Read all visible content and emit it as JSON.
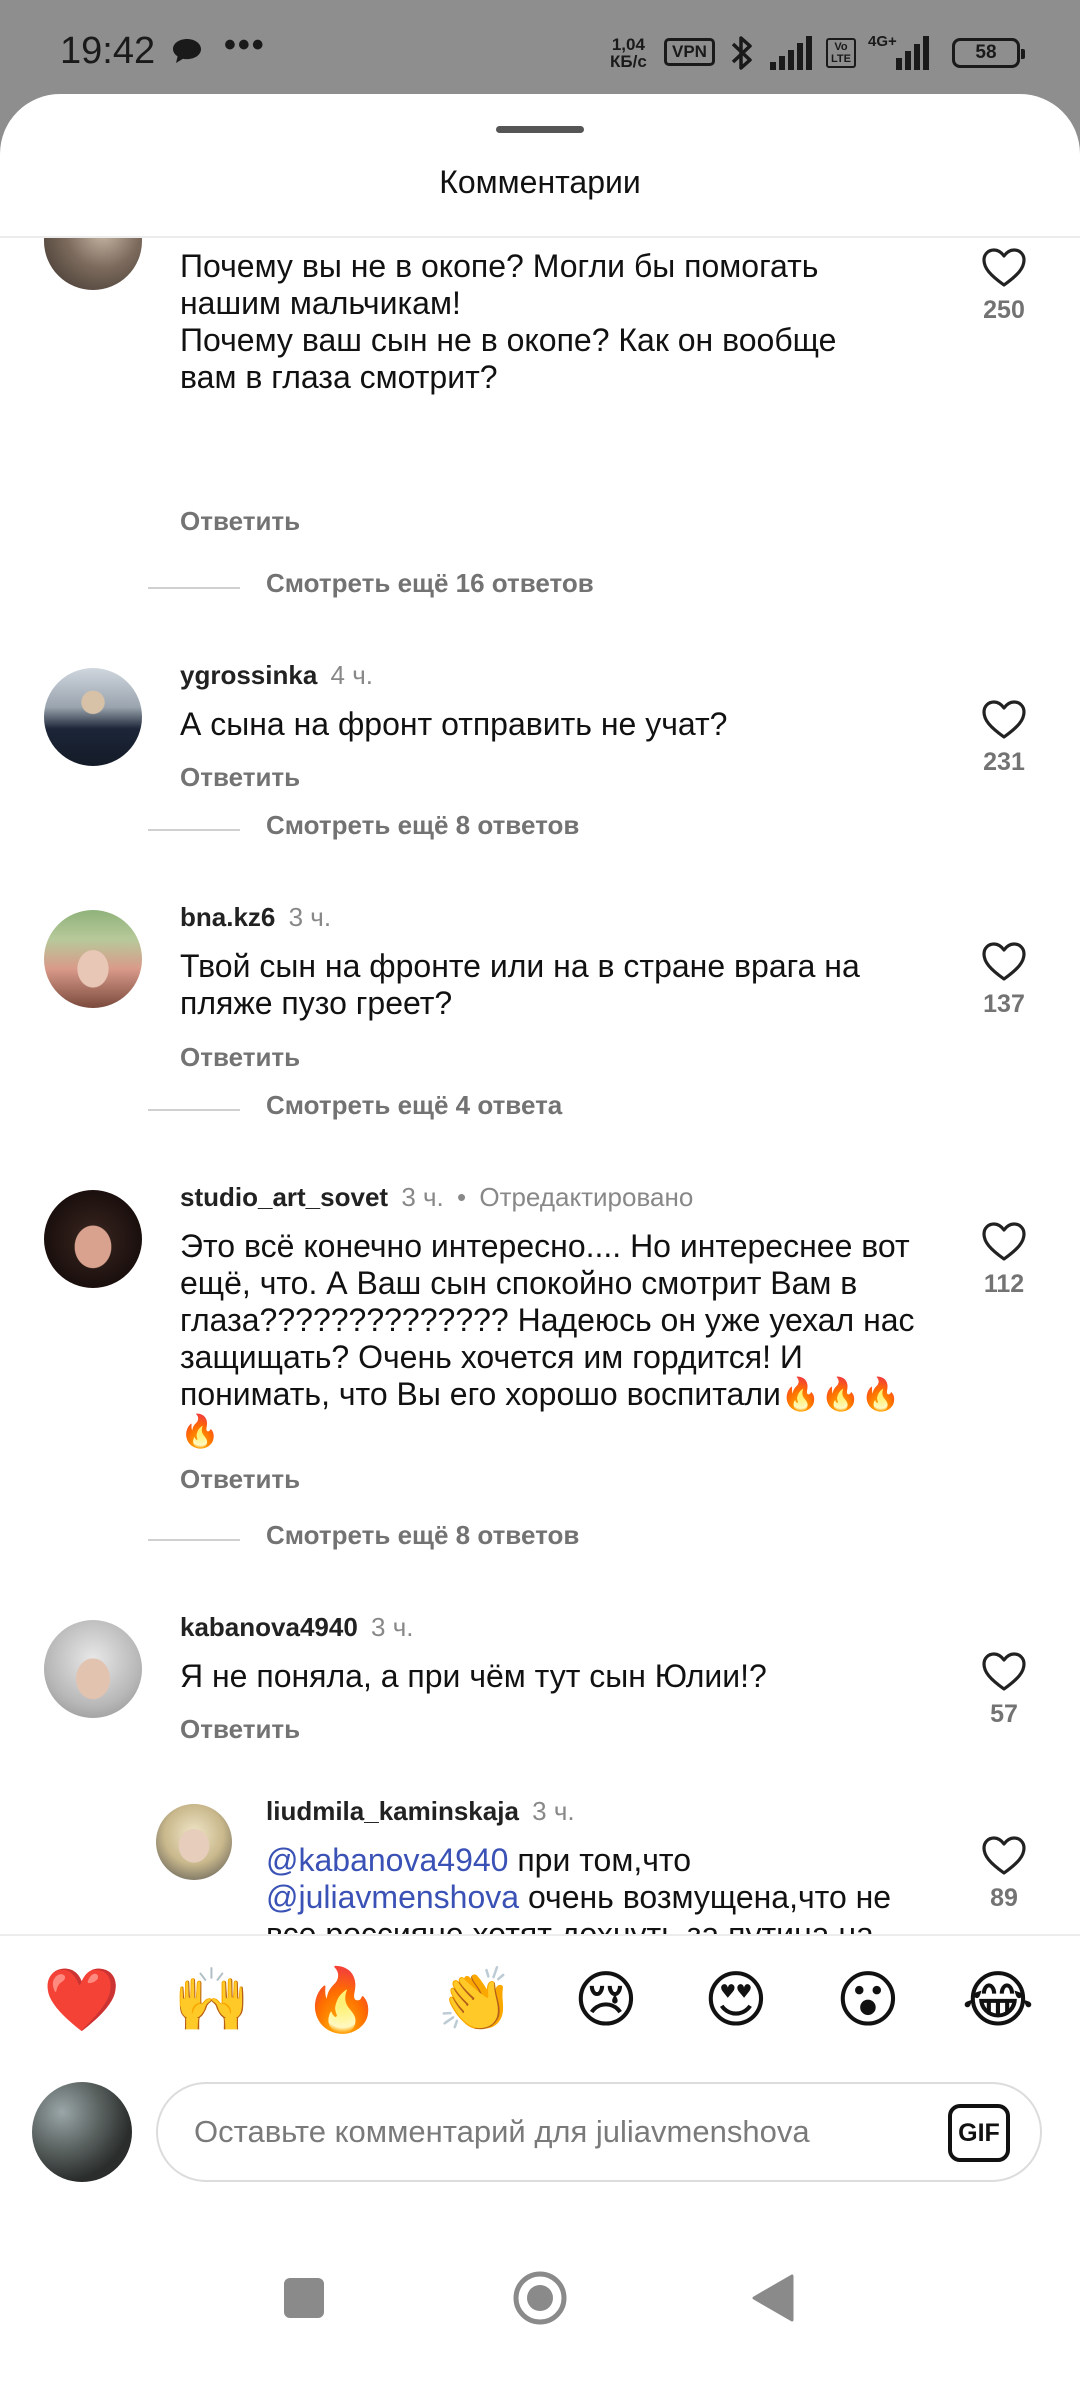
{
  "status_bar": {
    "time": "19:42",
    "net_speed_value": "1,04",
    "net_speed_unit": "КБ/с",
    "vpn": "VPN",
    "volte_top": "Vo",
    "volte_bottom": "LTE",
    "network": "4G+",
    "battery": "58",
    "icons": [
      "chat-bubble-icon",
      "more-dots-icon",
      "bluetooth-icon",
      "signal-icon",
      "signal-icon"
    ]
  },
  "sheet": {
    "title": "Комментарии"
  },
  "comments": [
    {
      "text": "Почему вы не в окопе? Могли бы помогать нашим мальчикам!\nПочему ваш сын не в окопе? Как он вообще вам в глаза смотрит?",
      "reply_label": "Ответить",
      "likes": "250",
      "more_replies": "Смотреть ещё 16 ответов"
    },
    {
      "username": "ygrossinka",
      "time": "4 ч.",
      "text": "А сына на фронт отправить не учат?",
      "reply_label": "Ответить",
      "likes": "231",
      "more_replies": "Смотреть ещё 8 ответов"
    },
    {
      "username": "bna.kz6",
      "time": "3 ч.",
      "text": "Твой сын на фронте или на в стране врага на пляже пузо греет?",
      "reply_label": "Ответить",
      "likes": "137",
      "more_replies": "Смотреть ещё 4 ответа"
    },
    {
      "username": "studio_art_sovet",
      "time": "3 ч.",
      "edited": "Отредактировано",
      "text": "Это всё конечно интересно.... Но интереснее вот ещё, что. А Ваш сын спокойно смотрит Вам в глаза?????????????? Надеюсь он уже уехал нас защищать? Очень хочется им гордится! И понимать, что Вы его хорошо воспитали🔥🔥🔥🔥",
      "reply_label": "Ответить",
      "likes": "112",
      "more_replies": "Смотреть ещё 8 ответов"
    },
    {
      "username": "kabanova4940",
      "time": "3 ч.",
      "text": "Я не поняла, а при чём тут сын Юлии!?",
      "reply_label": "Ответить",
      "likes": "57"
    }
  ],
  "reply": {
    "username": "liudmila_kaminskaja",
    "time": "3 ч.",
    "mention1": "@kabanova4940",
    "text1": " при том,что ",
    "mention2": "@juliavmenshova",
    "text2": " очень возмущена,что не все россияне хотят дохнуть за путина на чужой земле,что позволяют себе эмигрировать. А сына своего на вону не отправила,как и мужа,который во вражеской Юрмале отдыхает",
    "likes": "89"
  },
  "emoji_bar": [
    "❤️",
    "🙌",
    "🔥",
    "👏",
    "😢",
    "😍",
    "😮",
    "😂"
  ],
  "input": {
    "placeholder": "Оставьте комментарий для juliavmenshova",
    "gif_label": "GIF"
  },
  "colors": {
    "mention": "#3a52b5",
    "secondary_text": "#737373",
    "status_bar_bg": "#8e8e8e"
  }
}
